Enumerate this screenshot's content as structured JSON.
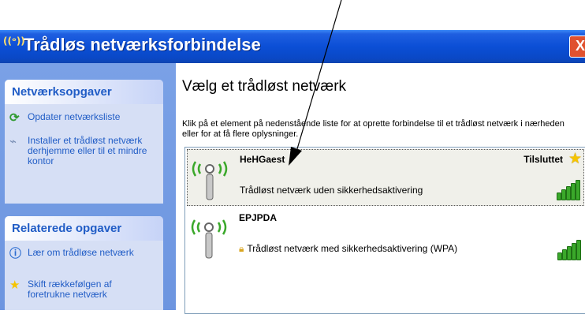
{
  "window": {
    "title": "Trådløs netværksforbindelse",
    "close_glyph": "X"
  },
  "left": {
    "tasks": {
      "header": "Netværksopgaver",
      "items": [
        {
          "label": "Opdater netværksliste",
          "icon": "refresh-icon"
        },
        {
          "label": "Installer et trådløst netværk derhjemme eller til et mindre kontor",
          "icon": "setup-wizard-icon"
        }
      ]
    },
    "related": {
      "header": "Relaterede opgaver",
      "items": [
        {
          "label": "Lær om trådløse netværk",
          "icon": "info-icon"
        },
        {
          "label": "Skift rækkefølgen af foretrukne netværk",
          "icon": "star-icon"
        }
      ]
    }
  },
  "main": {
    "heading": "Vælg et trådløst netværk",
    "description": "Klik på et element på nedenstående liste for at oprette forbindelse til et trådløst netværk i nærheden eller for at få flere oplysninger.",
    "networks": [
      {
        "name": "HeHGaest",
        "status": "Trådløst netværk uden sikkerhedsaktivering",
        "connection": "Tilsluttet",
        "secured": false,
        "signal_bars": 5
      },
      {
        "name": "EPJPDA",
        "status": "Trådløst netværk med sikkerhedsaktivering (WPA)",
        "connection": "",
        "secured": true,
        "signal_bars": 5
      }
    ]
  },
  "colors": {
    "title_bar": "#0b4fd6",
    "task_text": "#215dc6",
    "signal": "#3aa82a"
  }
}
